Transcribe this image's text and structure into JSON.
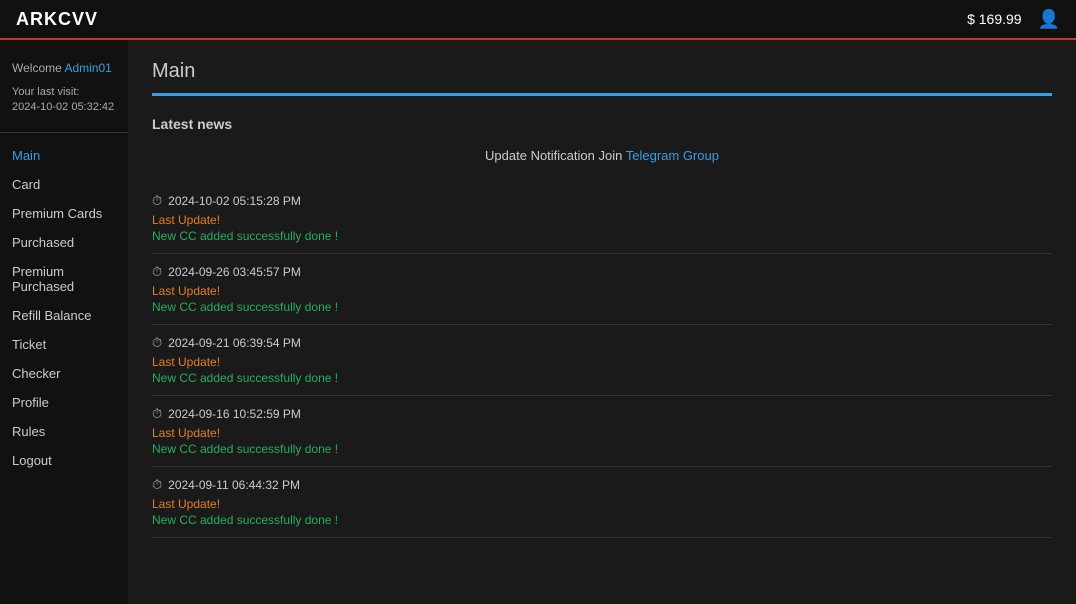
{
  "navbar": {
    "brand": "ARKCVV",
    "balance": "$ 169.99",
    "user_icon": "👤"
  },
  "sidebar": {
    "welcome_text": "Welcome",
    "username": "Admin01",
    "last_visit_label": "Your last visit:",
    "last_visit_time": "2024-10-02 05:32:42",
    "nav_items": [
      {
        "label": "Main",
        "active": true,
        "id": "main"
      },
      {
        "label": "Card",
        "active": false,
        "id": "card"
      },
      {
        "label": "Premium Cards",
        "active": false,
        "id": "premium-cards"
      },
      {
        "label": "Purchased",
        "active": false,
        "id": "purchased"
      },
      {
        "label": "Premium Purchased",
        "active": false,
        "id": "premium-purchased"
      },
      {
        "label": "Refill Balance",
        "active": false,
        "id": "refill-balance"
      },
      {
        "label": "Ticket",
        "active": false,
        "id": "ticket"
      },
      {
        "label": "Checker",
        "active": false,
        "id": "checker"
      },
      {
        "label": "Profile",
        "active": false,
        "id": "profile"
      },
      {
        "label": "Rules",
        "active": false,
        "id": "rules"
      },
      {
        "label": "Logout",
        "active": false,
        "id": "logout"
      }
    ]
  },
  "main": {
    "page_title": "Main",
    "latest_news_header": "Latest news",
    "notification_prefix": "Update Notification Join",
    "telegram_link_text": "Telegram Group",
    "news_items": [
      {
        "timestamp": "2024-10-02 05:15:28 PM",
        "last_update": "Last Update!",
        "message": "New CC added successfully done !"
      },
      {
        "timestamp": "2024-09-26 03:45:57 PM",
        "last_update": "Last Update!",
        "message": "New CC added successfully done !"
      },
      {
        "timestamp": "2024-09-21 06:39:54 PM",
        "last_update": "Last Update!",
        "message": "New CC added successfully done !"
      },
      {
        "timestamp": "2024-09-16 10:52:59 PM",
        "last_update": "Last Update!",
        "message": "New CC added successfully done !"
      },
      {
        "timestamp": "2024-09-11 06:44:32 PM",
        "last_update": "Last Update!",
        "message": "New CC added successfully done !"
      }
    ]
  }
}
